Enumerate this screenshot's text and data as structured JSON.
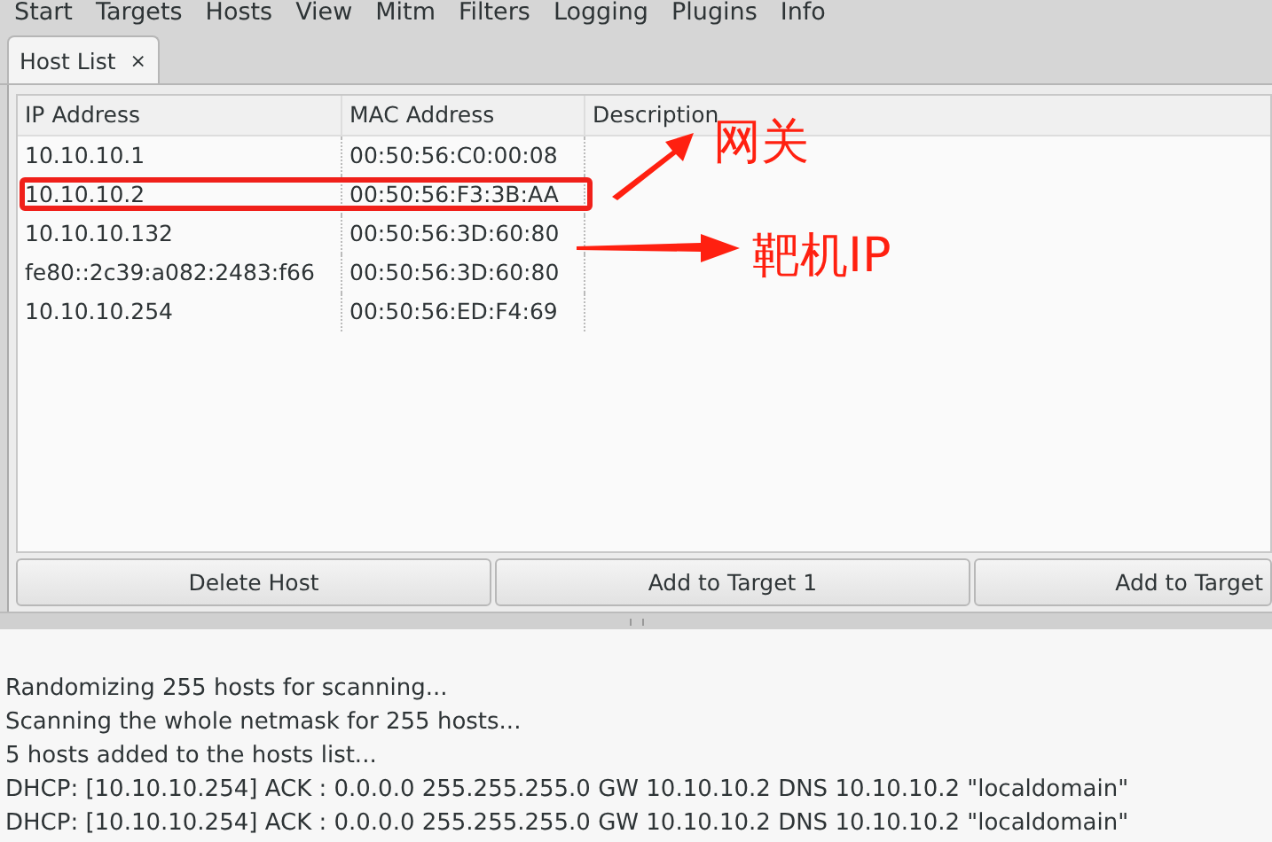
{
  "menu": [
    "Start",
    "Targets",
    "Hosts",
    "View",
    "Mitm",
    "Filters",
    "Logging",
    "Plugins",
    "Info"
  ],
  "tabs": [
    {
      "label": "Host List",
      "close": "×",
      "selected": true
    }
  ],
  "table": {
    "columns": [
      "IP Address",
      "MAC Address",
      "Description"
    ],
    "rows": [
      {
        "ip": "10.10.10.1",
        "mac": "00:50:56:C0:00:08",
        "highlighted": false
      },
      {
        "ip": "10.10.10.2",
        "mac": "00:50:56:F3:3B:AA",
        "highlighted": true
      },
      {
        "ip": "10.10.10.132",
        "mac": "00:50:56:3D:60:80",
        "highlighted": false
      },
      {
        "ip": "fe80::2c39:a082:2483:f66",
        "mac": "00:50:56:3D:60:80",
        "highlighted": false
      },
      {
        "ip": "10.10.10.254",
        "mac": "00:50:56:ED:F4:69",
        "highlighted": false
      }
    ]
  },
  "buttons": [
    "Delete Host",
    "Add to Target 1",
    "Add to Target"
  ],
  "log": [
    "Randomizing 255 hosts for scanning...",
    "Scanning the whole netmask for 255 hosts...",
    "5 hosts added to the hosts list...",
    "DHCP: [10.10.10.254] ACK : 0.0.0.0 255.255.255.0 GW 10.10.10.2 DNS 10.10.10.2 \"localdomain\"",
    "DHCP: [10.10.10.254] ACK : 0.0.0.0 255.255.255.0 GW 10.10.10.2 DNS 10.10.10.2 \"localdomain\""
  ],
  "annotations": [
    {
      "text": "网关"
    },
    {
      "text": "靶机IP"
    }
  ]
}
